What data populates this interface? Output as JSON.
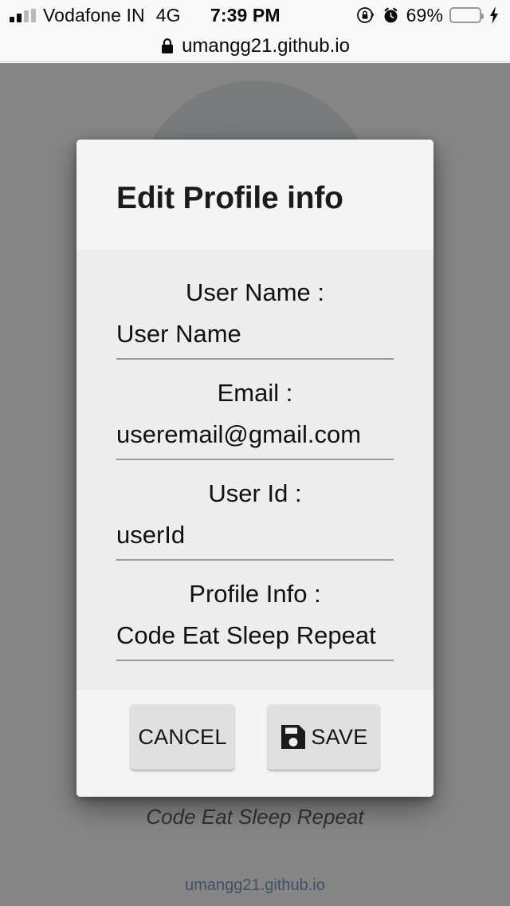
{
  "status_bar": {
    "signal_icon": "signal-bars-icon",
    "carrier": "Vodafone IN",
    "network": "4G",
    "time": "7:39 PM",
    "rotation_lock_icon": "rotation-lock-icon",
    "alarm_icon": "alarm-clock-icon",
    "battery_percent": "69%",
    "battery_fill_pct": 69,
    "battery_icon": "battery-icon",
    "charging_icon": "lightning-bolt-icon"
  },
  "browser": {
    "lock_icon": "lock-icon",
    "url": "umangg21.github.io"
  },
  "page_behind": {
    "avatar_icon": "profile-avatar",
    "caption": "Code Eat Sleep Repeat",
    "subtext": "umangg21.github.io"
  },
  "dialog": {
    "title": "Edit Profile info",
    "fields": [
      {
        "label": "User Name :",
        "value": "User Name",
        "placeholder": "User Name",
        "name": "user-name"
      },
      {
        "label": "Email :",
        "value": "useremail@gmail.com",
        "placeholder": "useremail@gmail.com",
        "name": "email"
      },
      {
        "label": "User Id :",
        "value": "userId",
        "placeholder": "userId",
        "name": "user-id"
      },
      {
        "label": "Profile Info :",
        "value": "Code Eat Sleep Repeat",
        "placeholder": "Code Eat Sleep Repeat",
        "name": "profile-info"
      }
    ],
    "cancel_label": "CANCEL",
    "save_label": "SAVE",
    "save_icon": "floppy-disk-icon"
  },
  "colors": {
    "dialog_header_bg": "#f4f4f4",
    "dialog_body_bg": "#ededed",
    "button_bg": "#e0e0e0",
    "underline": "#9a9a9a",
    "battery_green": "#35e064",
    "scrim": "rgba(60,60,60,0.62)"
  }
}
